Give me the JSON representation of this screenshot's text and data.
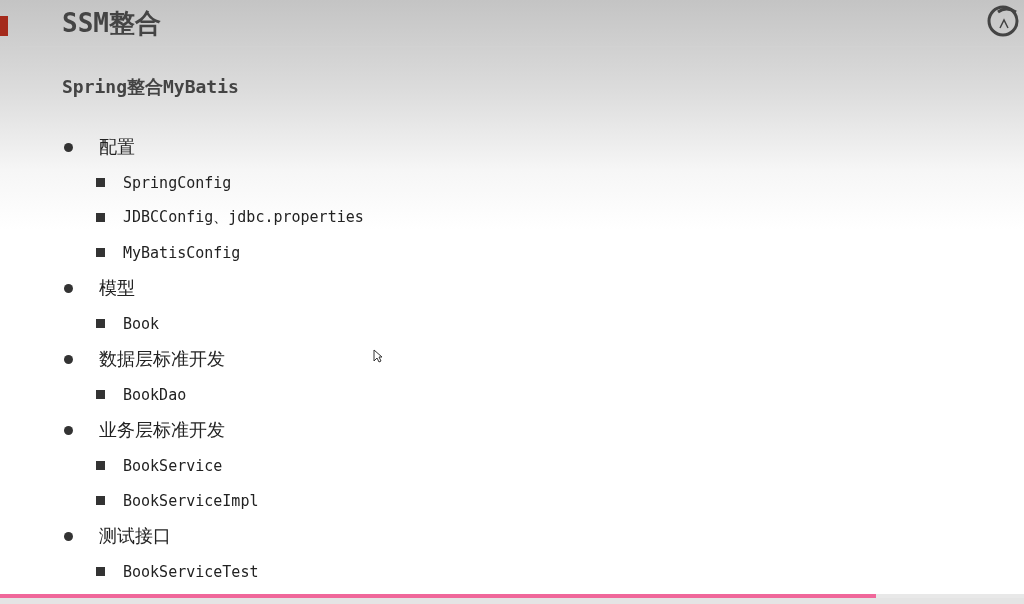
{
  "slide": {
    "title": "SSM整合",
    "subtitle": "Spring整合MyBatis",
    "items": [
      {
        "text": "配置",
        "children": [
          {
            "text": "SpringConfig"
          },
          {
            "text": "JDBCConfig、jdbc.properties"
          },
          {
            "text": "MyBatisConfig"
          }
        ]
      },
      {
        "text": "模型",
        "children": [
          {
            "text": "Book"
          }
        ]
      },
      {
        "text": "数据层标准开发",
        "children": [
          {
            "text": "BookDao"
          }
        ]
      },
      {
        "text": "业务层标准开发",
        "children": [
          {
            "text": "BookService"
          },
          {
            "text": "BookServiceImpl"
          }
        ]
      },
      {
        "text": "测试接口",
        "children": [
          {
            "text": "BookServiceTest"
          }
        ]
      }
    ]
  },
  "player": {
    "progress": {
      "level": 0.855
    }
  }
}
